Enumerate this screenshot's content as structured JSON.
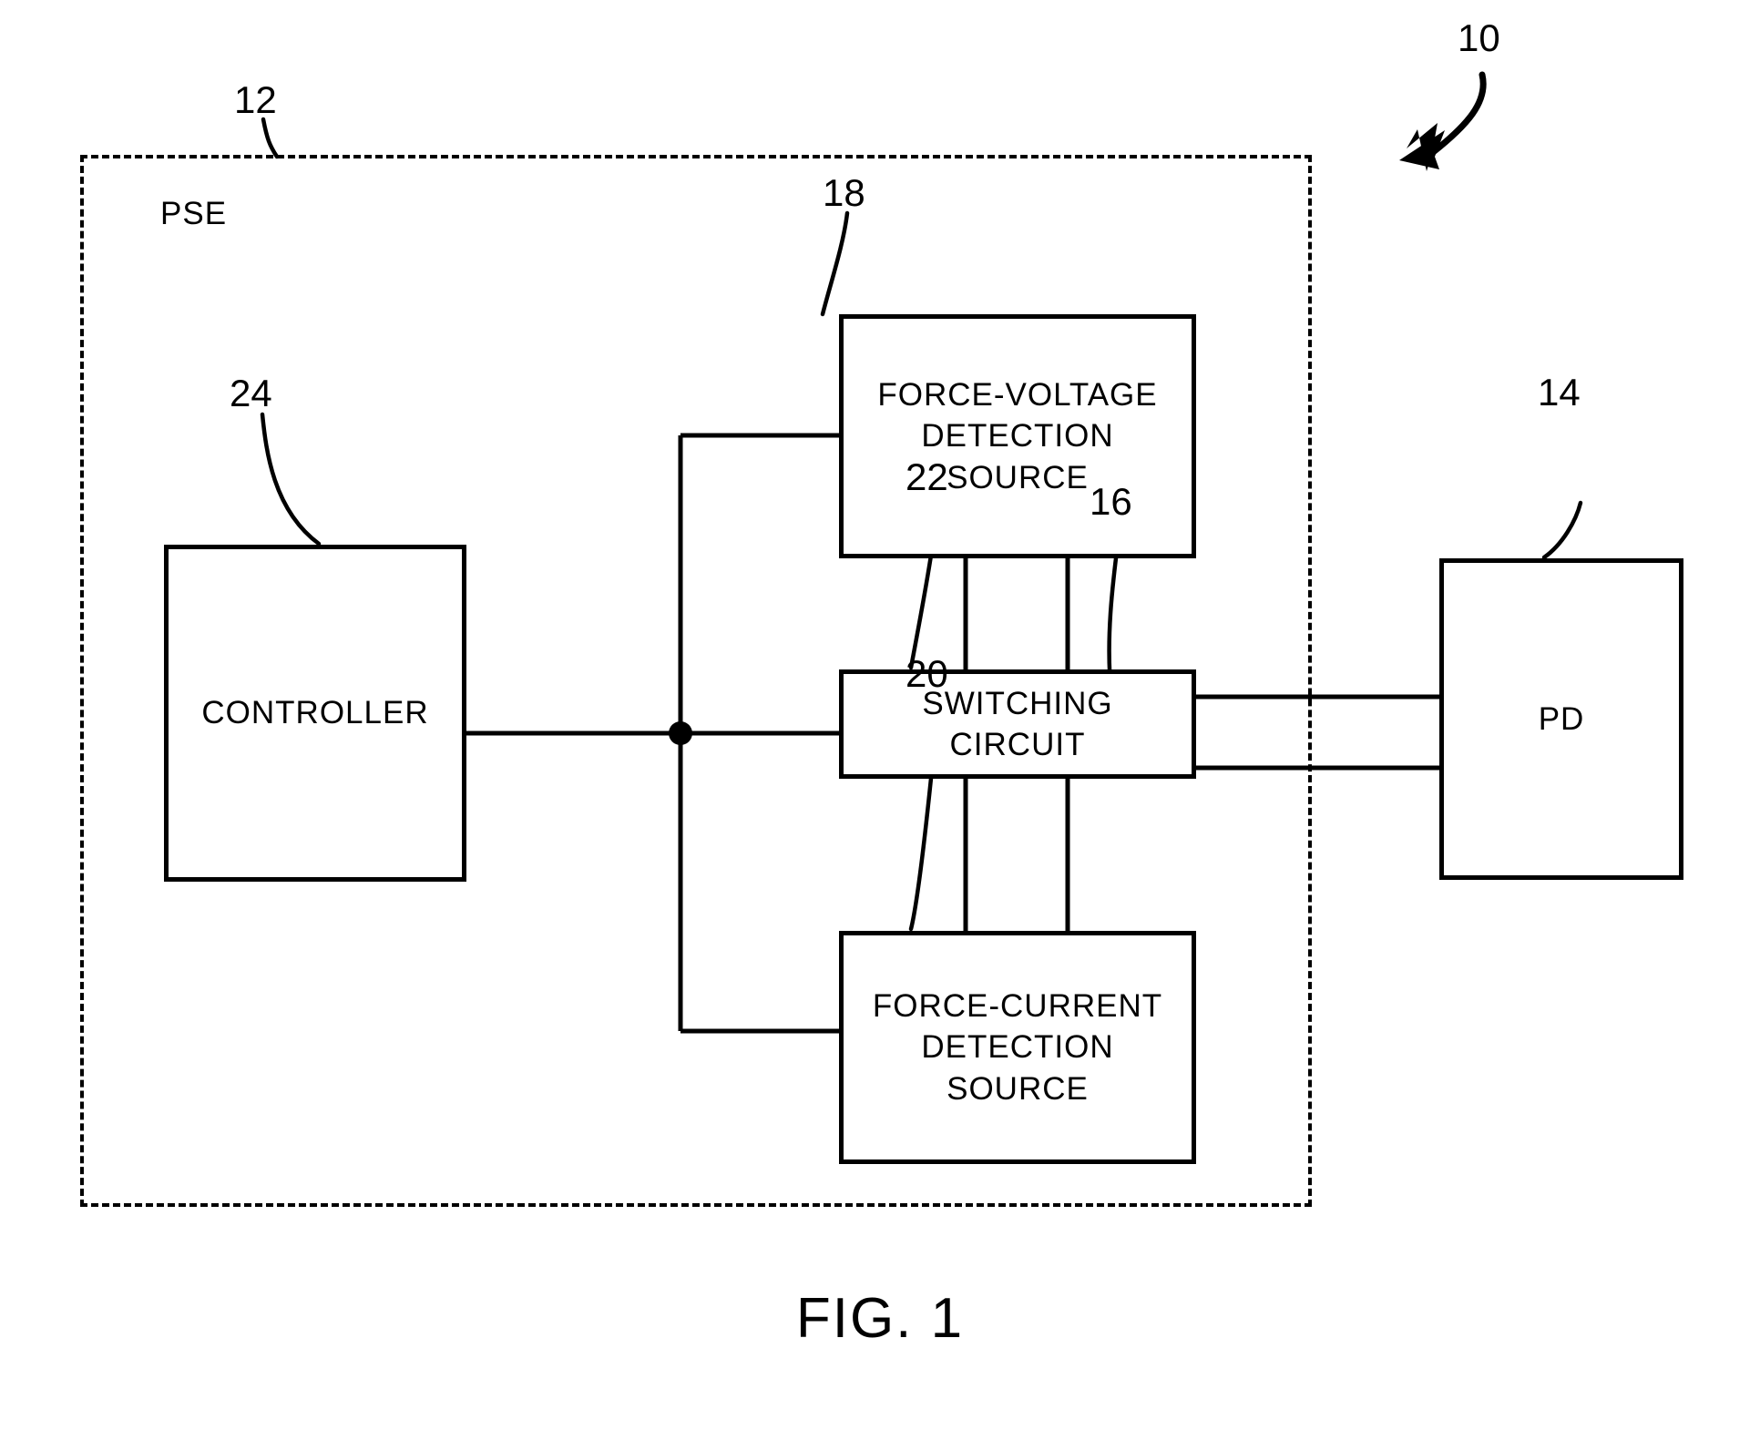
{
  "figure": {
    "caption": "FIG. 1",
    "enclosure_label": "PSE",
    "line_color": "#000000",
    "background_color": "#ffffff"
  },
  "blocks": [
    {
      "id": "fvds",
      "label": "FORCE-VOLTAGE\nDETECTION\nSOURCE",
      "ref": "18"
    },
    {
      "id": "switching",
      "label": "SWITCHING\nCIRCUIT",
      "ref": "22"
    },
    {
      "id": "fcds",
      "label": "FORCE-CURRENT\nDETECTION\nSOURCE",
      "ref": "20"
    },
    {
      "id": "controller",
      "label": "CONTROLLER",
      "ref": "24"
    },
    {
      "id": "pd",
      "label": "PD",
      "ref": "14"
    }
  ],
  "reference_numerals": {
    "system": "10",
    "pse": "12",
    "pd": "14",
    "link": "16",
    "force_voltage_source": "18",
    "force_current_source": "20",
    "switching_circuit": "22",
    "controller": "24"
  }
}
